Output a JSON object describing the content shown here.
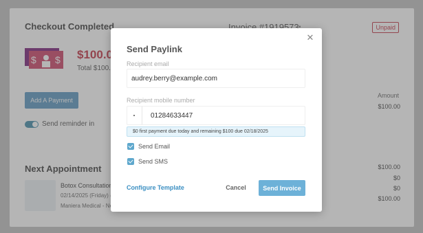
{
  "background": {
    "title": "Checkout Completed",
    "invoice_number": "Invoice #1919573",
    "status_badge": "Unpaid",
    "amount": "$100.0",
    "total_line": "Total $100.0",
    "add_payment_label": "Add A Payment",
    "reminder_label": "Send reminder in",
    "amount_header": "Amount",
    "amount_rows": [
      "$100.00",
      "$100.00",
      "$0",
      "$0",
      "$100.00"
    ],
    "next_appointment_title": "Next Appointment",
    "appointment": {
      "name": "Botox Consultation",
      "date": "02/14/2025 (Friday) @",
      "location": "Maniera Medical - New"
    }
  },
  "modal": {
    "title": "Send Paylink",
    "email_label": "Recipient email",
    "email_value": "audrey.berry@example.com",
    "phone_label": "Recipient mobile number",
    "phone_value": "01284633447",
    "note": "$0 first payment due today and remaining $100 due 02/18/2025",
    "send_email_label": "Send Email",
    "send_sms_label": "Send SMS",
    "configure_label": "Configure Template",
    "cancel_label": "Cancel",
    "submit_label": "Send Invoice",
    "close_symbol": "✕"
  },
  "colors": {
    "accent": "#6db1d8",
    "link": "#3b8fc2",
    "danger": "#c94b5a"
  }
}
